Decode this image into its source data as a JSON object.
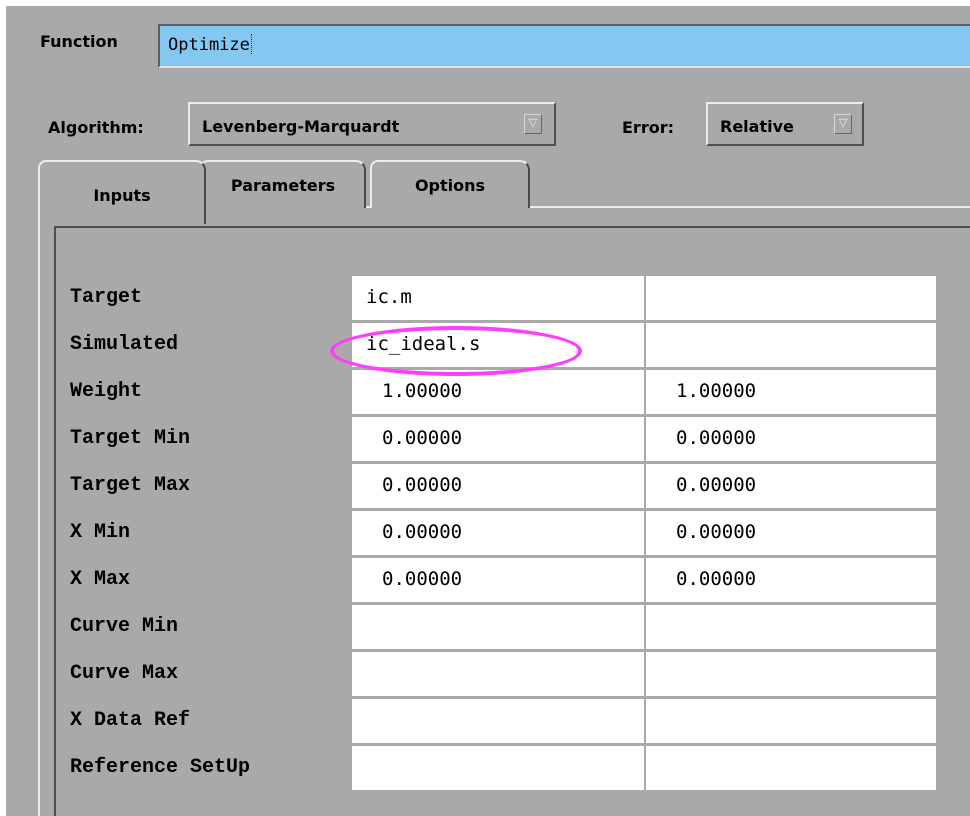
{
  "function": {
    "label": "Function",
    "value": "Optimize"
  },
  "algorithm": {
    "label": "Algorithm:",
    "value": "Levenberg-Marquardt"
  },
  "error": {
    "label": "Error:",
    "value": "Relative"
  },
  "tabs": [
    {
      "label": "Inputs",
      "active": true
    },
    {
      "label": "Parameters",
      "active": false
    },
    {
      "label": "Options",
      "active": false
    }
  ],
  "table": {
    "rows": [
      {
        "label": "Target",
        "col1": "ic.m",
        "col2": ""
      },
      {
        "label": "Simulated",
        "col1": "ic_ideal.s",
        "col2": ""
      },
      {
        "label": "Weight",
        "col1": "1.00000",
        "col2": "1.00000"
      },
      {
        "label": "Target Min",
        "col1": "0.00000",
        "col2": "0.00000"
      },
      {
        "label": "Target Max",
        "col1": "0.00000",
        "col2": "0.00000"
      },
      {
        "label": "X Min",
        "col1": "0.00000",
        "col2": "0.00000"
      },
      {
        "label": "X Max",
        "col1": "0.00000",
        "col2": "0.00000"
      },
      {
        "label": "Curve Min",
        "col1": "",
        "col2": ""
      },
      {
        "label": "Curve Max",
        "col1": "",
        "col2": ""
      },
      {
        "label": "X Data Ref",
        "col1": "",
        "col2": ""
      },
      {
        "label": "Reference SetUp",
        "col1": "",
        "col2": ""
      }
    ]
  },
  "colors": {
    "function_field_bg": "#84c8f2",
    "panel_bg": "#a9a9a9",
    "highlight": "#ff3cff"
  }
}
